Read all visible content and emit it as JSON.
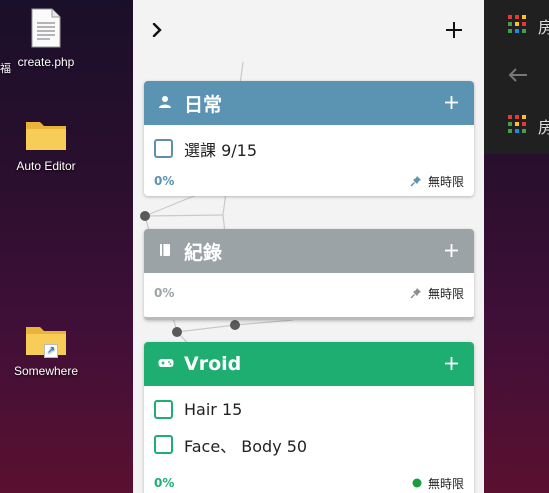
{
  "desktop": {
    "edge_text": "福",
    "icons": [
      {
        "name": "create.php",
        "type": "document"
      },
      {
        "name": "Auto Editor",
        "type": "folder"
      },
      {
        "name": "Somewhere",
        "type": "folder-shortcut"
      }
    ]
  },
  "app": {
    "toolbar": {
      "expand_icon": "chevron-right-icon",
      "add_icon": "plus-icon"
    },
    "cards": [
      {
        "title": "日常",
        "icon": "person-icon",
        "color": "#5b93b3",
        "tasks": [
          "選課 9/15"
        ],
        "progress": "0%",
        "progress_color": "#5b93b3",
        "due": "無時限",
        "due_icon": "pin-icon",
        "due_color": "#5b93b3"
      },
      {
        "title": "紀錄",
        "icon": "book-icon",
        "color": "#9ca3a7",
        "tasks": [],
        "progress": "0%",
        "progress_color": "#9ca3a7",
        "due": "無時限",
        "due_icon": "pin-icon",
        "due_color": "#8a8f93"
      },
      {
        "title": "Vroid",
        "icon": "gamepad-icon",
        "color": "#1fae72",
        "tasks": [
          "Hair 15",
          "Face、 Body 50"
        ],
        "progress": "0%",
        "progress_color": "#1fae72",
        "due": "無時限",
        "due_icon": "dot-icon",
        "due_color": "#1a9c3f"
      }
    ]
  },
  "side_panel": {
    "rows": [
      {
        "icon": "app-grid-icon",
        "text": "房"
      },
      {
        "icon": "back-arrow-icon",
        "text": ""
      },
      {
        "icon": "app-grid-icon",
        "text": "房"
      }
    ]
  }
}
